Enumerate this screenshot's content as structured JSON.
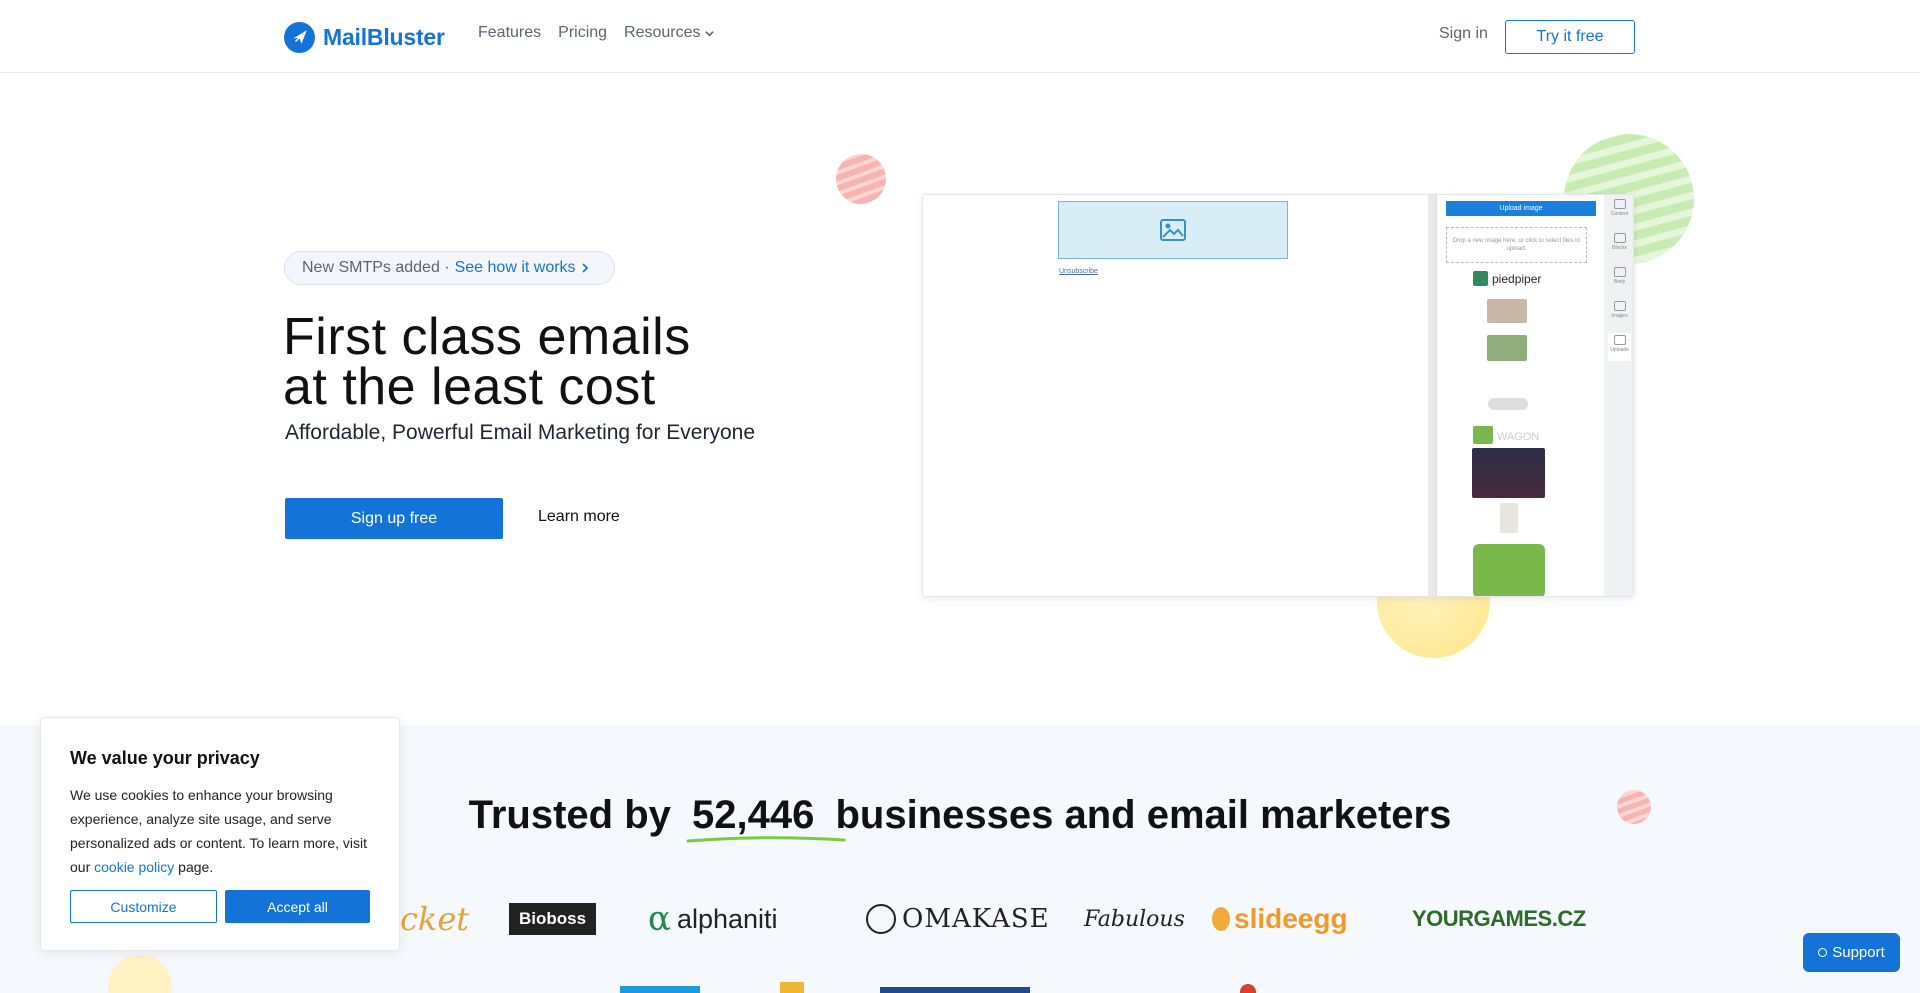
{
  "header": {
    "brand": "MailBluster",
    "nav": [
      {
        "label": "Features"
      },
      {
        "label": "Pricing"
      },
      {
        "label": "Resources"
      }
    ],
    "signin_label": "Sign in",
    "try_label": "Try it free"
  },
  "hero": {
    "pill_text": "New SMTPs added ·",
    "pill_link": "See how it works",
    "headline_line1": "First class emails",
    "headline_line2": "at the least cost",
    "subhead": "Affordable, Powerful Email Marketing for Everyone",
    "signup_label": "Sign up free",
    "learn_more_label": "Learn more"
  },
  "editor": {
    "unsubscribe": "Unsubscribe",
    "upload_label": "Upload image",
    "dropzone_text": "Drop a new image here, or click to select files to upload.",
    "brand1": "piedpiper",
    "brand2": "WAGON",
    "tools": [
      "Content",
      "Blocks",
      "Body",
      "Images",
      "Uploads"
    ]
  },
  "trusted": {
    "prefix": "Trusted by",
    "count": "52,446",
    "suffix": "businesses and email marketers",
    "logos": [
      "cket",
      "Bioboss",
      "alphaniti",
      "OMAKASE",
      "Fabulous",
      "slideegg",
      "YOURGAMES.CZ"
    ]
  },
  "cookie": {
    "title": "We value your privacy",
    "text_before_link": "We use cookies to enhance your browsing experience, analyze site usage, and serve personalized ads or content. To learn more, visit our",
    "link_label": "cookie policy",
    "text_after_link": "page.",
    "customize_label": "Customize",
    "accept_label": "Accept all"
  },
  "support": {
    "label": "Support"
  },
  "colors": {
    "brand": "#1473d9",
    "text": "#1f2430",
    "muted": "#5c6470",
    "section_bg": "#f5f8fc"
  }
}
